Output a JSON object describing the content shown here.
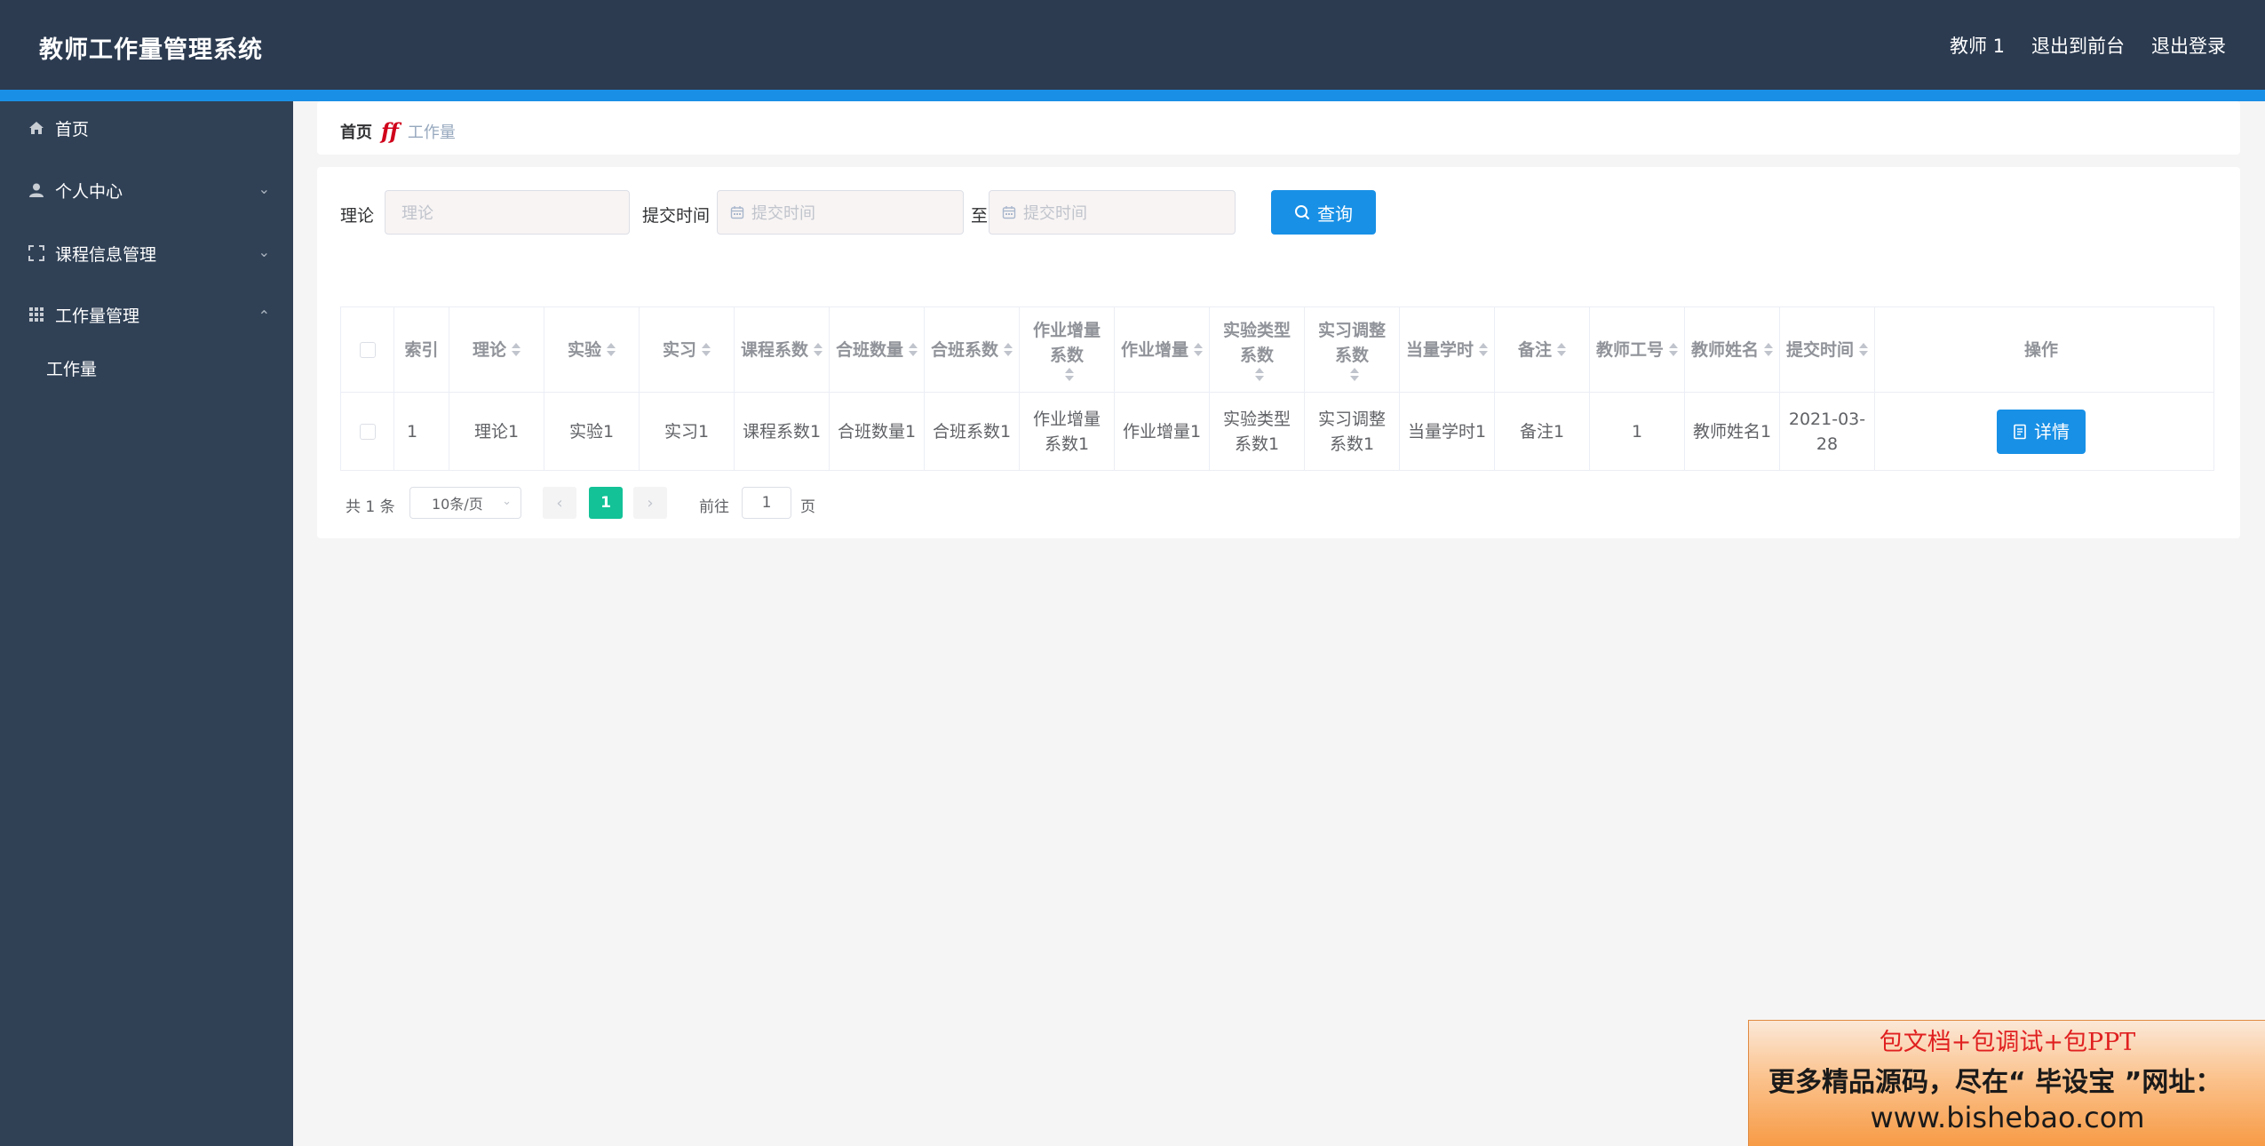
{
  "header": {
    "title": "教师工作量管理系统",
    "links": [
      "教师 1",
      "退出到前台",
      "退出登录"
    ]
  },
  "sidebar": {
    "items": [
      {
        "label": "首页",
        "icon": "home-icon"
      },
      {
        "label": "个人中心",
        "icon": "user-icon"
      },
      {
        "label": "课程信息管理",
        "icon": "frame-icon"
      },
      {
        "label": "工作量管理",
        "icon": "grid-icon"
      }
    ],
    "subitems": [
      "工作量"
    ]
  },
  "breadcrumb": {
    "home": "首页",
    "separator": "ff",
    "current": "工作量"
  },
  "search": {
    "theory_label": "理论",
    "theory_placeholder": "理论",
    "time_label": "提交时间",
    "start_placeholder": "提交时间",
    "to_label": "至",
    "end_placeholder": "提交时间",
    "button_label": "查询"
  },
  "table": {
    "headers": [
      {
        "key": "index",
        "label": "索引",
        "sortable": false
      },
      {
        "key": "theory",
        "label": "理论",
        "sortable": true
      },
      {
        "key": "experiment",
        "label": "实验",
        "sortable": true
      },
      {
        "key": "internship",
        "label": "实习",
        "sortable": true
      },
      {
        "key": "course_coef",
        "label": "课程系数",
        "sortable": true
      },
      {
        "key": "merge_count",
        "label": "合班数量",
        "sortable": true
      },
      {
        "key": "merge_coef",
        "label": "合班系数",
        "sortable": true
      },
      {
        "key": "hw_inc_coef",
        "label": "作业增量系数",
        "sortable": true
      },
      {
        "key": "hw_inc",
        "label": "作业增量",
        "sortable": true
      },
      {
        "key": "exp_type_coef",
        "label": "实验类型系数",
        "sortable": true
      },
      {
        "key": "intern_adj_coef",
        "label": "实习调整系数",
        "sortable": true
      },
      {
        "key": "equiv_hours",
        "label": "当量学时",
        "sortable": true
      },
      {
        "key": "remark",
        "label": "备注",
        "sortable": true
      },
      {
        "key": "teacher_no",
        "label": "教师工号",
        "sortable": true
      },
      {
        "key": "teacher_name",
        "label": "教师姓名",
        "sortable": true
      },
      {
        "key": "submit_time",
        "label": "提交时间",
        "sortable": true
      },
      {
        "key": "actions",
        "label": "操作",
        "sortable": false
      }
    ],
    "rows": [
      [
        "1",
        "理论1",
        "实验1",
        "实习1",
        "课程系数1",
        "合班数量1",
        "合班系数1",
        "作业增量系数1",
        "作业增量1",
        "实验类型系数1",
        "实习调整系数1",
        "当量学时1",
        "备注1",
        "1",
        "教师姓名1",
        "2021-03-28"
      ]
    ],
    "detail_label": "详情"
  },
  "pagination": {
    "total": "共 1 条",
    "page_size": "10条/页",
    "current_page": "1",
    "goto_label": "前往",
    "goto_value": "1",
    "page_label": "页"
  },
  "ad": {
    "line1": "包文档+包调试+包PPT",
    "line2": "更多精品源码，尽在“ 毕设宝 ”网址：",
    "line3": "www.bishebao.com"
  },
  "colors": {
    "topbar": "#2c3b50",
    "accent": "#1a8fe6",
    "sidebar": "#304156",
    "primary_button": "#1890e6",
    "active_page": "#13c297"
  }
}
